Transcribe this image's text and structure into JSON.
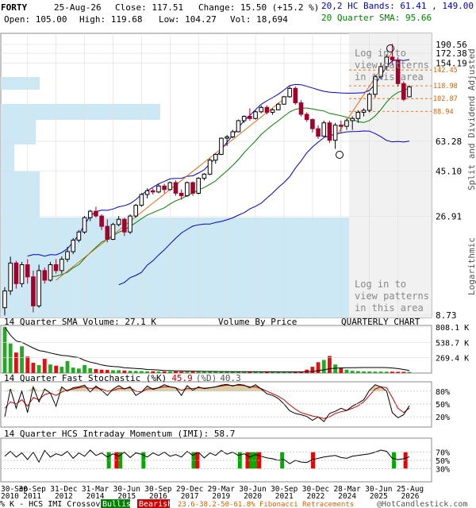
{
  "header": {
    "ticker": "FORTY",
    "date": "25-Aug-26",
    "close_label": "Close: 117.51",
    "change_label": "Change: 15.50 (+15.2 %)",
    "open_label": "Open: 105.00",
    "high_label": "High: 119.68",
    "low_label": "Low: 104.27",
    "vol_label": "Vol: 18,694",
    "bands_label": "20,2 HC Bands: 61.41 , 149.00",
    "sma_label": "20 Quarter SMA: 95.66"
  },
  "overlay": {
    "login_text": [
      "Log in to",
      "view patterns",
      "in this area"
    ],
    "side_label_top": "Split and Dividend Adjusted",
    "side_label_bottom": "Logarithmic"
  },
  "chart_data": [
    {
      "type": "candlestick",
      "period": "quarterly",
      "scale": "log",
      "y_tick_labels": [
        "190.56",
        "172.38",
        "154.19",
        "63.28",
        "45.10",
        "26.91",
        "8.73"
      ],
      "fib_levels": [
        "142.45",
        "118.98",
        "102.87",
        "88.94"
      ],
      "colors": {
        "up": "#000000",
        "down": "#a0002a",
        "sma": "#008000",
        "bands": "#0000cc",
        "trend": "#e06000"
      },
      "ohlc": [
        [
          9.5,
          12.0,
          8.7,
          11.5
        ],
        [
          11.5,
          17.0,
          11.0,
          15.8
        ],
        [
          15.8,
          16.2,
          11.8,
          12.5
        ],
        [
          12.5,
          16.0,
          12.0,
          15.5
        ],
        [
          15.5,
          16.5,
          12.5,
          13.5
        ],
        [
          13.5,
          14.5,
          9.0,
          9.7
        ],
        [
          9.7,
          15.5,
          9.5,
          14.5
        ],
        [
          14.5,
          15.0,
          12.5,
          13.0
        ],
        [
          13.0,
          16.0,
          12.8,
          15.5
        ],
        [
          15.5,
          16.5,
          14.0,
          14.5
        ],
        [
          14.5,
          17.0,
          14.0,
          16.5
        ],
        [
          16.5,
          19.0,
          16.0,
          18.0
        ],
        [
          18.0,
          21.0,
          17.5,
          20.5
        ],
        [
          20.5,
          23.0,
          20.0,
          22.5
        ],
        [
          22.5,
          27.0,
          22.0,
          26.5
        ],
        [
          26.5,
          29.0,
          25.5,
          28.5
        ],
        [
          28.5,
          30.0,
          26.5,
          27.0
        ],
        [
          27.0,
          27.5,
          23.0,
          24.0
        ],
        [
          24.0,
          26.0,
          20.0,
          20.7
        ],
        [
          20.7,
          25.0,
          20.5,
          24.5
        ],
        [
          24.5,
          27.0,
          24.0,
          26.0
        ],
        [
          26.0,
          26.5,
          21.5,
          22.5
        ],
        [
          22.5,
          27.5,
          22.0,
          27.0
        ],
        [
          27.0,
          31.0,
          26.5,
          30.5
        ],
        [
          30.5,
          35.0,
          30.0,
          34.5
        ],
        [
          34.5,
          37.0,
          33.0,
          36.0
        ],
        [
          36.0,
          37.0,
          34.5,
          35.5
        ],
        [
          35.5,
          39.0,
          35.0,
          38.0
        ],
        [
          38.0,
          39.0,
          35.0,
          36.5
        ],
        [
          36.5,
          40.0,
          36.0,
          39.5
        ],
        [
          39.5,
          40.5,
          34.0,
          35.0
        ],
        [
          35.0,
          36.5,
          32.5,
          34.0
        ],
        [
          34.0,
          40.0,
          33.5,
          39.5
        ],
        [
          39.5,
          40.0,
          34.0,
          35.0
        ],
        [
          35.0,
          42.0,
          34.5,
          41.5
        ],
        [
          41.5,
          44.0,
          40.5,
          43.5
        ],
        [
          43.5,
          52.0,
          43.0,
          51.0
        ],
        [
          51.0,
          55.0,
          49.0,
          54.5
        ],
        [
          54.5,
          66.0,
          54.0,
          65.5
        ],
        [
          65.5,
          68.0,
          60.0,
          66.5
        ],
        [
          66.5,
          72.0,
          65.5,
          70.5
        ],
        [
          70.5,
          81.0,
          70.0,
          80.0
        ],
        [
          80.0,
          85.0,
          78.0,
          84.0
        ],
        [
          84.0,
          92.0,
          80.0,
          82.0
        ],
        [
          82.0,
          90.0,
          81.0,
          88.5
        ],
        [
          88.5,
          95.0,
          87.0,
          93.0
        ],
        [
          93.0,
          95.0,
          86.0,
          88.0
        ],
        [
          88.0,
          92.0,
          85.5,
          90.5
        ],
        [
          90.5,
          98.0,
          90.0,
          96.5
        ],
        [
          96.5,
          106.0,
          96.0,
          105.0
        ],
        [
          105.0,
          118.0,
          104.0,
          115.5
        ],
        [
          115.5,
          118.0,
          96.0,
          98.0
        ],
        [
          98.0,
          101.0,
          84.0,
          86.0
        ],
        [
          86.0,
          88.0,
          79.0,
          81.0
        ],
        [
          81.0,
          82.0,
          70.0,
          73.0
        ],
        [
          73.0,
          76.0,
          65.0,
          67.0
        ],
        [
          67.0,
          80.0,
          66.5,
          78.0
        ],
        [
          78.0,
          80.0,
          62.0,
          64.0
        ],
        [
          64.0,
          78.0,
          58.0,
          76.0
        ],
        [
          76.0,
          80.0,
          70.0,
          75.0
        ],
        [
          75.0,
          82.0,
          72.0,
          80.0
        ],
        [
          80.0,
          84.0,
          72.0,
          82.0
        ],
        [
          82.0,
          90.0,
          78.0,
          88.0
        ],
        [
          88.0,
          92.0,
          84.0,
          90.0
        ],
        [
          90.0,
          110.0,
          88.0,
          108.0
        ],
        [
          108.0,
          135.0,
          104.0,
          132.0
        ],
        [
          132.0,
          155.0,
          128.0,
          148.0
        ],
        [
          148.0,
          170.0,
          142.0,
          165.0
        ],
        [
          165.0,
          192.0,
          150.0,
          160.0
        ],
        [
          160.0,
          165.0,
          118.0,
          122.0
        ],
        [
          122.0,
          125.0,
          100.0,
          102.0
        ],
        [
          105.0,
          119.68,
          104.27,
          117.51
        ]
      ]
    },
    {
      "type": "bar",
      "title": "14 Quarter SMA Volume: 27.1 K",
      "subtitle": "Volume By Price",
      "tag": "QUARTERLY CHART",
      "y_tick_labels": [
        "808.1 K",
        "538.7 K",
        "269.4 K"
      ],
      "ylim": [
        0,
        808.1
      ],
      "values": [
        810,
        520,
        360,
        470,
        290,
        180,
        140,
        250,
        150,
        130,
        110,
        210,
        95,
        80,
        140,
        85,
        70,
        60,
        55,
        50,
        50,
        45,
        40,
        38,
        35,
        32,
        32,
        30,
        30,
        28,
        28,
        26,
        26,
        25,
        25,
        24,
        24,
        23,
        23,
        22,
        22,
        22,
        22,
        22,
        20,
        20,
        20,
        20,
        18,
        18,
        18,
        20,
        25,
        60,
        110,
        190,
        230,
        300,
        150,
        90,
        60,
        40,
        35,
        30,
        28,
        25,
        25,
        24,
        24,
        22,
        22,
        20
      ]
    },
    {
      "type": "line",
      "title": "14 Quarter Fast Stochastic (%K)",
      "k_label": "(%K)",
      "d_label": "(%D)",
      "k_value": "45.9",
      "d_value": "40.3",
      "y_tick_labels": [
        "80%",
        "50%",
        "20%"
      ],
      "ylim": [
        0,
        100
      ],
      "k": [
        20,
        85,
        40,
        80,
        30,
        90,
        55,
        85,
        75,
        45,
        90,
        80,
        88,
        90,
        94,
        78,
        92,
        82,
        70,
        85,
        93,
        85,
        90,
        70,
        78,
        92,
        84,
        88,
        95,
        90,
        88,
        70,
        93,
        82,
        90,
        86,
        88,
        90,
        94,
        96,
        92,
        96,
        94,
        88,
        95,
        85,
        74,
        70,
        63,
        50,
        34,
        28,
        25,
        21,
        12,
        20,
        9,
        28,
        33,
        40,
        35,
        45,
        52,
        60,
        82,
        95,
        90,
        80,
        30,
        18,
        25,
        45.9
      ],
      "d": [
        40,
        55,
        50,
        60,
        45,
        65,
        60,
        72,
        76,
        70,
        78,
        83,
        85,
        88,
        90,
        86,
        88,
        85,
        80,
        82,
        86,
        86,
        88,
        80,
        78,
        85,
        86,
        88,
        90,
        90,
        88,
        82,
        86,
        86,
        88,
        87,
        88,
        90,
        92,
        94,
        93,
        94,
        93,
        90,
        90,
        86,
        80,
        74,
        68,
        60,
        48,
        38,
        30,
        26,
        22,
        20,
        16,
        20,
        28,
        32,
        35,
        40,
        46,
        55,
        70,
        85,
        90,
        88,
        65,
        40,
        30,
        40.3
      ]
    },
    {
      "type": "line",
      "title": "14 Quarter HCS Intraday Momentum (IMI): 58.7",
      "y_tick_labels": [
        "70%",
        "50%",
        "30%"
      ],
      "ylim": [
        0,
        100
      ],
      "values": [
        60,
        72,
        58,
        68,
        52,
        70,
        46,
        74,
        58,
        66,
        62,
        72,
        55,
        68,
        60,
        75,
        62,
        68,
        58,
        66,
        60,
        70,
        57,
        68,
        65,
        58,
        68,
        62,
        70,
        60,
        64,
        58,
        72,
        62,
        70,
        56,
        68,
        62,
        74,
        65,
        70,
        62,
        66,
        58,
        64,
        60,
        56,
        54,
        50,
        52,
        42,
        50,
        46,
        45,
        52,
        55,
        58,
        60,
        62,
        57,
        55,
        60,
        62,
        64,
        66,
        70,
        75,
        72,
        55,
        52,
        54,
        58.7
      ],
      "crossovers": [
        {
          "q": 27,
          "kind": "bullish"
        },
        {
          "q": 29,
          "kind": "bearish"
        },
        {
          "q": 30,
          "kind": "bullish"
        },
        {
          "q": 36,
          "kind": "bullish"
        },
        {
          "q": 49,
          "kind": "bullish"
        },
        {
          "q": 50,
          "kind": "bearish"
        },
        {
          "q": 61,
          "kind": "bullish"
        },
        {
          "q": 63,
          "kind": "bearish"
        },
        {
          "q": 64,
          "kind": "bullish"
        },
        {
          "q": 65,
          "kind": "bullish"
        },
        {
          "q": 66,
          "kind": "bearish"
        },
        {
          "q": 72,
          "kind": "bullish"
        },
        {
          "q": 80,
          "kind": "bearish"
        },
        {
          "q": 101,
          "kind": "bullish"
        },
        {
          "q": 104,
          "kind": "bearish"
        }
      ]
    }
  ],
  "x_axis": {
    "dates": [
      "30-Sep 2010",
      "30-Sep 2011",
      "31-Dec 2012",
      "31-Mar 2014",
      "30-Jun 2015",
      "30-Sep 2016",
      "29-Dec 2017",
      "29-Mar 2019",
      "30-Jun 2020",
      "30-Sep 2021",
      "30-Dec 2022",
      "28-Mar 2024",
      "30-Jun 2025",
      "25-Aug 2026"
    ]
  },
  "footer": {
    "imi_label": "% K - HCS IMI Crossover,",
    "bullish": "Bullish",
    "bearish": "Bearish",
    "fib_label": "23.6-38.2-50-61.8% Fibonacci Retracements",
    "copyright": "@HotCandlestick.com"
  }
}
